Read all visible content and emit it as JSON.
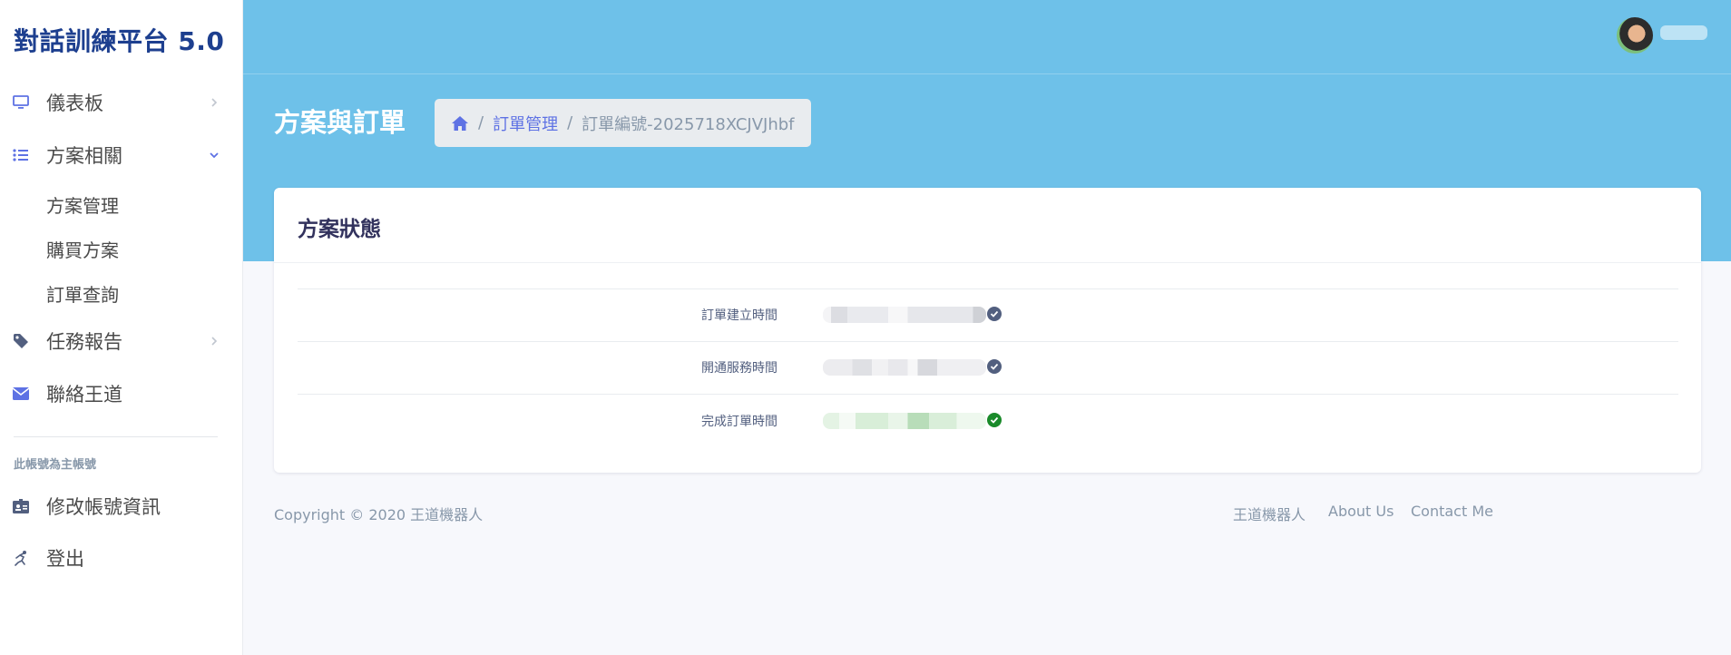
{
  "brand": "對話訓練平台 5.0",
  "sidebar": {
    "items": [
      {
        "label": "儀表板",
        "icon": "monitor-icon"
      },
      {
        "label": "方案相關",
        "icon": "list-icon",
        "expanded": true,
        "sub_items": [
          {
            "label": "方案管理"
          },
          {
            "label": "購買方案"
          },
          {
            "label": "訂單查詢"
          }
        ]
      },
      {
        "label": "任務報告",
        "icon": "tag-icon"
      },
      {
        "label": "聯絡王道",
        "icon": "envelope-icon"
      }
    ],
    "section_heading": "此帳號為主帳號",
    "account_items": [
      {
        "label": "修改帳號資訊",
        "icon": "id-card-icon"
      },
      {
        "label": "登出",
        "icon": "running-icon"
      }
    ]
  },
  "header": {
    "page_title": "方案與訂單",
    "breadcrumb": {
      "home_icon": "home-icon",
      "link": "訂單管理",
      "current": "訂單編號-2025718XCJVJhbf"
    }
  },
  "card": {
    "title": "方案狀態",
    "rows": [
      {
        "label": "訂單建立時間",
        "status": "done",
        "check_color": "#525f7f"
      },
      {
        "label": "開通服務時間",
        "status": "done",
        "check_color": "#525f7f"
      },
      {
        "label": "完成訂單時間",
        "status": "complete",
        "check_color": "#1a8a2a"
      }
    ]
  },
  "footer": {
    "copyright": "Copyright © 2020 王道機器人",
    "links": [
      "王道機器人",
      "About Us",
      "Contact Me"
    ]
  },
  "colors": {
    "accent": "#5e72e4",
    "header": "#6ec1e9",
    "brand": "#1d3f8f"
  }
}
